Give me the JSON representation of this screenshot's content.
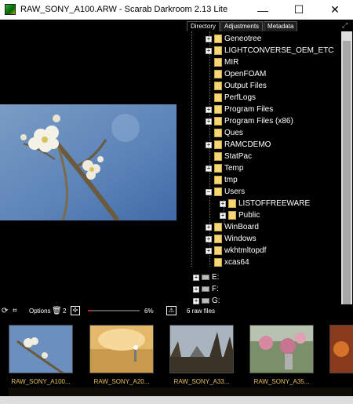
{
  "window": {
    "title": "RAW_SONY_A100.ARW - Scarab Darkroom 2.13 Lite",
    "min_glyph": "—",
    "max_glyph": "☐",
    "close_glyph": "✕"
  },
  "tabs": [
    "Directory",
    "Adjustments",
    "Metadata"
  ],
  "tree": {
    "folders": [
      {
        "label": "Geneotree",
        "expandable": true
      },
      {
        "label": "LIGHTCONVERSE_OEM_ETC",
        "expandable": true
      },
      {
        "label": "MIR",
        "expandable": false
      },
      {
        "label": "OpenFOAM",
        "expandable": false
      },
      {
        "label": "Output Files",
        "expandable": false
      },
      {
        "label": "PerfLogs",
        "expandable": false
      },
      {
        "label": "Program Files",
        "expandable": true
      },
      {
        "label": "Program Files (x86)",
        "expandable": true
      },
      {
        "label": "Ques",
        "expandable": false
      },
      {
        "label": "RAMCDEMO",
        "expandable": true
      },
      {
        "label": "StatPac",
        "expandable": false
      },
      {
        "label": "Temp",
        "expandable": true
      },
      {
        "label": "tmp",
        "expandable": false
      },
      {
        "label": "Users",
        "expandable": true,
        "expanded": true
      }
    ],
    "user_children": [
      {
        "label": "LISTOFFREEWARE",
        "expandable": true
      },
      {
        "label": "Public",
        "expandable": true
      }
    ],
    "folders_after": [
      {
        "label": "WinBoard",
        "expandable": true
      },
      {
        "label": "Windows",
        "expandable": true
      },
      {
        "label": "wkhtmltopdf",
        "expandable": true
      },
      {
        "label": "xcas64",
        "expandable": false
      }
    ],
    "drives": [
      "E:",
      "F:",
      "G:"
    ]
  },
  "toolbar": {
    "options_label": "Options",
    "count_label": "2",
    "zoom_percent": "6%",
    "zoom_value": 6
  },
  "status": {
    "file_count": "6 raw files"
  },
  "thumbnails": [
    {
      "label": "RAW_SONY_A100..."
    },
    {
      "label": "RAW_SONY_A20..."
    },
    {
      "label": "RAW_SONY_A33..."
    },
    {
      "label": "RAW_SONY_A35..."
    }
  ],
  "colors": {
    "folder": "#f6d67a",
    "thumb_label": "#e6c15c",
    "progress": "#cc2222"
  }
}
